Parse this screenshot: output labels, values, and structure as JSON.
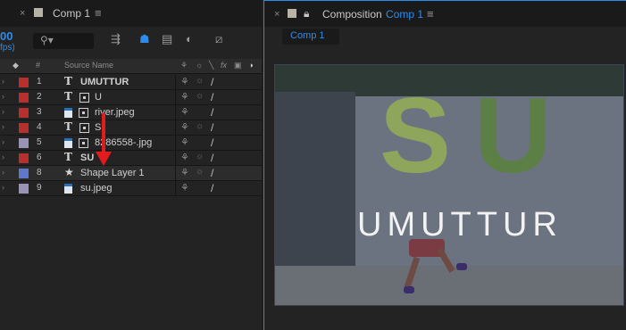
{
  "project_panel": {
    "tab_title": "Comp 1",
    "fps_value": "00",
    "fps_unit": "fps)",
    "search_icon": "search-icon",
    "column_headers": {
      "source_name": "Source Name",
      "number": "#"
    },
    "layers": [
      {
        "num": "1",
        "type": "text",
        "name": "UMUTTUR",
        "label_color": "#b8302d"
      },
      {
        "num": "2",
        "type": "text-box",
        "name": "U",
        "label_color": "#b8302d"
      },
      {
        "num": "3",
        "type": "image-box",
        "name": "river.jpeg",
        "label_color": "#b8302d"
      },
      {
        "num": "4",
        "type": "text-box",
        "name": "S",
        "label_color": "#b8302d"
      },
      {
        "num": "5",
        "type": "image-box",
        "name": "8286558-.jpg",
        "label_color": "#9a93b8"
      },
      {
        "num": "6",
        "type": "text",
        "name": "SU",
        "label_color": "#b8302d"
      },
      {
        "num": "8",
        "type": "shape",
        "name": "Shape Layer 1",
        "label_color": "#5e79c9"
      },
      {
        "num": "9",
        "type": "image",
        "name": "su.jpeg",
        "label_color": "#9a93b8"
      }
    ]
  },
  "composition_panel": {
    "tab_prefix": "Composition",
    "tab_comp_name": "Comp 1",
    "comp_tab_label": "Comp 1",
    "viewer_letters": {
      "s": "S",
      "u": "U"
    },
    "wordmark": "UMUTTUR"
  },
  "colors": {
    "accent": "#2d8ceb",
    "annotation_arrow": "#e21c1c"
  }
}
